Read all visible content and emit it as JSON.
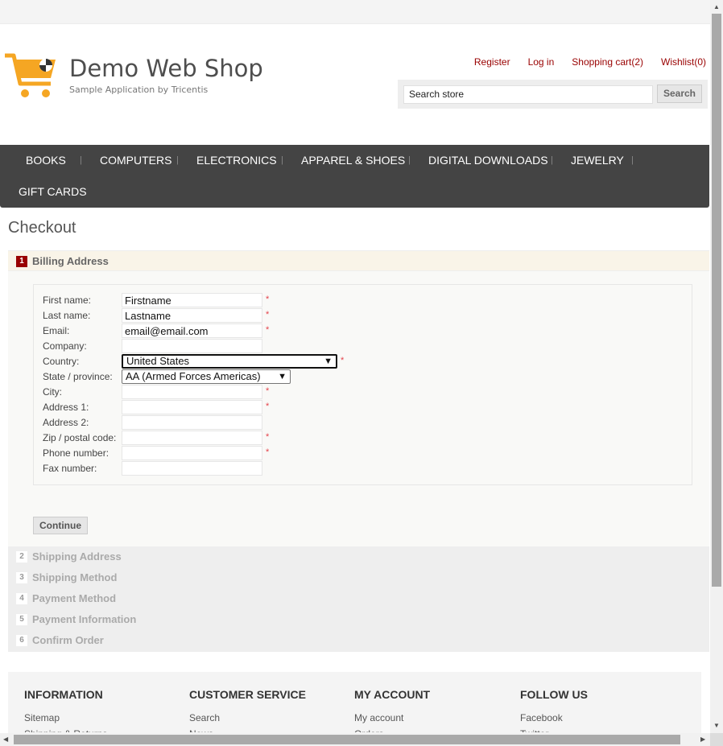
{
  "header": {
    "title": "Demo Web Shop",
    "subtitle": "Sample Application by Tricentis",
    "links": {
      "register": "Register",
      "login": "Log in",
      "cart": "Shopping cart(2)",
      "wishlist": "Wishlist(0)"
    },
    "search": {
      "value": "Search store",
      "button": "Search"
    }
  },
  "nav": {
    "items": [
      "BOOKS",
      "COMPUTERS",
      "ELECTRONICS",
      "APPAREL & SHOES",
      "DIGITAL DOWNLOADS",
      "JEWELRY",
      "GIFT CARDS"
    ]
  },
  "checkout": {
    "title": "Checkout",
    "active_step": {
      "num": "1",
      "label": "Billing Address"
    },
    "fields": {
      "first_name": {
        "label": "First name:",
        "value": "Firstname"
      },
      "last_name": {
        "label": "Last name:",
        "value": "Lastname"
      },
      "email": {
        "label": "Email:",
        "value": "email@email.com"
      },
      "company": {
        "label": "Company:",
        "value": ""
      },
      "country": {
        "label": "Country:",
        "value": "United States"
      },
      "state": {
        "label": "State / province:",
        "value": "AA (Armed Forces Americas)"
      },
      "city": {
        "label": "City:",
        "value": ""
      },
      "address1": {
        "label": "Address 1:",
        "value": ""
      },
      "address2": {
        "label": "Address 2:",
        "value": ""
      },
      "zip": {
        "label": "Zip / postal code:",
        "value": ""
      },
      "phone": {
        "label": "Phone number:",
        "value": ""
      },
      "fax": {
        "label": "Fax number:",
        "value": ""
      }
    },
    "required_mark": "*",
    "continue": "Continue",
    "other_steps": [
      {
        "num": "2",
        "label": "Shipping Address"
      },
      {
        "num": "3",
        "label": "Shipping Method"
      },
      {
        "num": "4",
        "label": "Payment Method"
      },
      {
        "num": "5",
        "label": "Payment Information"
      },
      {
        "num": "6",
        "label": "Confirm Order"
      }
    ]
  },
  "footer": {
    "columns": [
      {
        "title": "INFORMATION",
        "first": "Sitemap",
        "second": "Shipping & Returns"
      },
      {
        "title": "CUSTOMER SERVICE",
        "first": "Search",
        "second": "News"
      },
      {
        "title": "MY ACCOUNT",
        "first": "My account",
        "second": "Orders"
      },
      {
        "title": "FOLLOW US",
        "first": "Facebook",
        "second": "Twitter"
      }
    ]
  },
  "colors": {
    "accent": "#990000",
    "nav_bg": "#444444",
    "logo": "#f5a623"
  }
}
